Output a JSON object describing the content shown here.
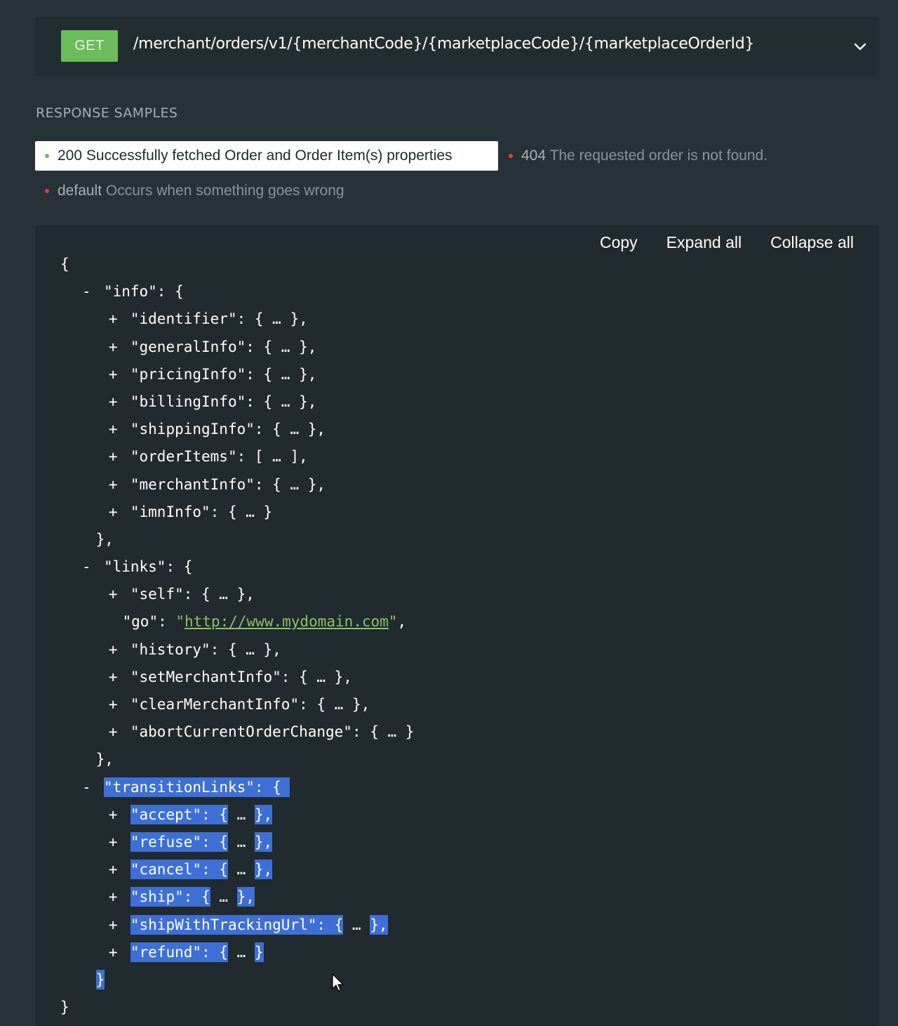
{
  "endpoint": {
    "method": "GET",
    "path": "/merchant/orders/v1/{merchantCode}/{marketplaceCode}/{marketplaceOrderId}",
    "expand_icon": "chevron-down-icon"
  },
  "response_samples": {
    "title": "RESPONSE SAMPLES",
    "tabs": [
      {
        "code": "200",
        "label": "Successfully fetched Order and Order Item(s) properties",
        "status": "success",
        "active": true
      },
      {
        "code": "404",
        "label": "The requested order is not found.",
        "status": "error",
        "active": false
      },
      {
        "code": "default",
        "label": "Occurs when something goes wrong",
        "status": "error",
        "active": false
      }
    ]
  },
  "toolbar": {
    "copy": "Copy",
    "expand_all": "Expand all",
    "collapse_all": "Collapse all"
  },
  "json_lines": {
    "open": "{",
    "info_key": "\"info\": {",
    "info_items": [
      "\"identifier\": { … },",
      "\"generalInfo\": { … },",
      "\"pricingInfo\": { … },",
      "\"billingInfo\": { … },",
      "\"shippingInfo\": { … },",
      "\"orderItems\": [ … ],",
      "\"merchantInfo\": { … },",
      "\"imnInfo\": { … }"
    ],
    "info_close": "},",
    "links_key": "\"links\": {",
    "links_self": "\"self\": { … },",
    "links_go_key": "\"go\": ",
    "links_go_value": "http://www.mydomain.com",
    "links_items": [
      "\"history\": { … },",
      "\"setMerchantInfo\": { … },",
      "\"clearMerchantInfo\": { … },",
      "\"abortCurrentOrderChange\": { … }"
    ],
    "links_close": "},",
    "transition_key": "\"transitionLinks\": { ",
    "transition_items": [
      {
        "key": "\"accept\": {",
        "rest": " … ",
        "end": "},"
      },
      {
        "key": "\"refuse\": {",
        "rest": " … ",
        "end": "},"
      },
      {
        "key": "\"cancel\": {",
        "rest": " … ",
        "end": "},"
      },
      {
        "key": "\"ship\": {",
        "rest": " … ",
        "end": "},"
      },
      {
        "key": "\"shipWithTrackingUrl\": {",
        "rest": " … ",
        "end": "},"
      },
      {
        "key": "\"refund\": {",
        "rest": " … ",
        "end": "}"
      }
    ],
    "transition_close": "}",
    "close": "}",
    "expand_symbol": "+",
    "collapse_symbol": "-"
  }
}
